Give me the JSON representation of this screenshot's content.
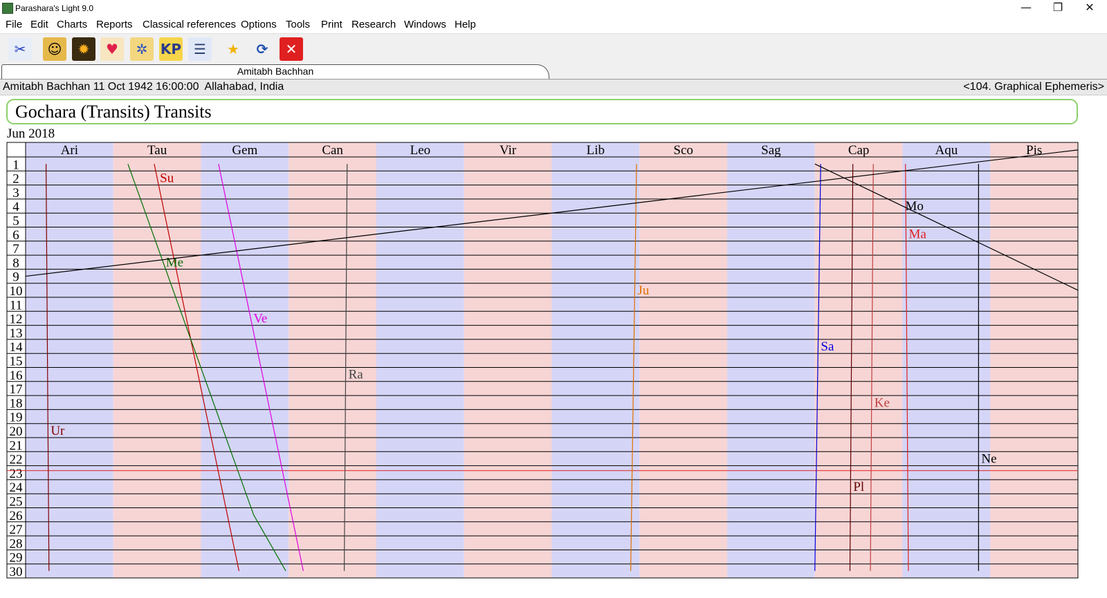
{
  "window": {
    "title": "Parashara's Light 9.0",
    "controls": {
      "minimize": "—",
      "restore": "❐",
      "close": "✕"
    }
  },
  "menu": [
    "File",
    "Edit",
    "Charts",
    "Reports",
    "Classical references",
    "Options",
    "Tools",
    "Print",
    "Research",
    "Windows",
    "Help"
  ],
  "toolbar": [
    {
      "name": "tools-icon",
      "glyph": "✂",
      "bg": "#e8eef7",
      "color": "#2040c0"
    },
    {
      "name": "person-icon",
      "glyph": "☺",
      "bg": "#e5b84a",
      "color": "#000"
    },
    {
      "name": "sun-icon",
      "glyph": "✹",
      "bg": "#3a2a10",
      "color": "#ffb020"
    },
    {
      "name": "heart-icon",
      "glyph": "♥",
      "bg": "#f7e6c0",
      "color": "#e0204a"
    },
    {
      "name": "wheel-icon",
      "glyph": "✲",
      "bg": "#f3d780",
      "color": "#3050c0"
    },
    {
      "name": "kp-icon",
      "glyph": "KP",
      "bg": "#f6d54a",
      "color": "#2a3a8a"
    },
    {
      "name": "chat-icon",
      "glyph": "☰",
      "bg": "#e0e8f8",
      "color": "#304070"
    },
    {
      "name": "star-icon",
      "glyph": "★",
      "bg": "#f0f0f0",
      "color": "#f0b400"
    },
    {
      "name": "refresh-icon",
      "glyph": "⟳",
      "bg": "#f0f0f0",
      "color": "#2050b0"
    },
    {
      "name": "close-chart-icon",
      "glyph": "✕",
      "bg": "#e02020",
      "color": "#ffffff"
    }
  ],
  "tab": {
    "label": "Amitabh Bachhan"
  },
  "info": {
    "left": "Amitabh Bachhan 11 Oct 1942 16:00:00  Allahabad, India",
    "right": "<104. Graphical Ephemeris>"
  },
  "chart_data": {
    "type": "line",
    "title": "Gochara (Transits) Transits",
    "subtitle": "Jun 2018",
    "signs": [
      "Ari",
      "Tau",
      "Gem",
      "Can",
      "Leo",
      "Vir",
      "Lib",
      "Sco",
      "Sag",
      "Cap",
      "Aqu",
      "Pis"
    ],
    "days": [
      1,
      2,
      3,
      4,
      5,
      6,
      7,
      8,
      9,
      10,
      11,
      12,
      13,
      14,
      15,
      16,
      17,
      18,
      19,
      20,
      21,
      22,
      23,
      24,
      25,
      26,
      27,
      28,
      29,
      30
    ],
    "x_unit": "sidereal longitude (degrees)",
    "xlim": [
      0,
      360
    ],
    "ylim": [
      1,
      30
    ],
    "current_day": 23,
    "colors": {
      "aries_band": "#d5d5f7",
      "taurus_band": "#f7d5d5",
      "grid": "#000000",
      "current_day_line": "#e02020"
    },
    "series": [
      {
        "name": "Su",
        "color": "#c00000",
        "label_day": 2,
        "points": [
          [
            44,
            1
          ],
          [
            73,
            30
          ]
        ]
      },
      {
        "name": "Me",
        "color": "#007000",
        "label_day": 8,
        "points": [
          [
            35,
            1
          ],
          [
            78,
            26
          ],
          [
            89,
            30
          ]
        ]
      },
      {
        "name": "Ve",
        "color": "#e000e0",
        "label_day": 12,
        "points": [
          [
            66,
            1
          ],
          [
            95,
            30
          ]
        ]
      },
      {
        "name": "Ra",
        "color": "#444444",
        "label_day": 16,
        "points": [
          [
            110,
            1
          ],
          [
            109,
            30
          ]
        ]
      },
      {
        "name": "Ju",
        "color": "#e07000",
        "label_day": 10,
        "points": [
          [
            209,
            1
          ],
          [
            207,
            30
          ]
        ]
      },
      {
        "name": "Sa",
        "color": "#0000e0",
        "label_day": 14,
        "points": [
          [
            272,
            1
          ],
          [
            270,
            30
          ]
        ]
      },
      {
        "name": "Pl",
        "color": "#600000",
        "label_day": 24,
        "points": [
          [
            283,
            1
          ],
          [
            282,
            30
          ]
        ]
      },
      {
        "name": "Ma",
        "color": "#e02020",
        "label_day": 6,
        "points": [
          [
            301,
            1
          ],
          [
            302,
            30
          ]
        ]
      },
      {
        "name": "Ke",
        "color": "#c04040",
        "label_day": 18,
        "points": [
          [
            290,
            1
          ],
          [
            289,
            30
          ]
        ]
      },
      {
        "name": "Ne",
        "color": "#000000",
        "label_day": 22,
        "points": [
          [
            326,
            1
          ],
          [
            326,
            30
          ]
        ]
      },
      {
        "name": "Ur",
        "color": "#800000",
        "label_day": 20,
        "points": [
          [
            7,
            1
          ],
          [
            8,
            30
          ]
        ]
      },
      {
        "name": "Mo",
        "color": "#000000",
        "label_day": 4,
        "segments": [
          [
            [
              270,
              1
            ],
            [
              360,
              10
            ]
          ],
          [
            [
              0,
              9
            ],
            [
              360,
              0
            ]
          ]
        ]
      }
    ]
  }
}
